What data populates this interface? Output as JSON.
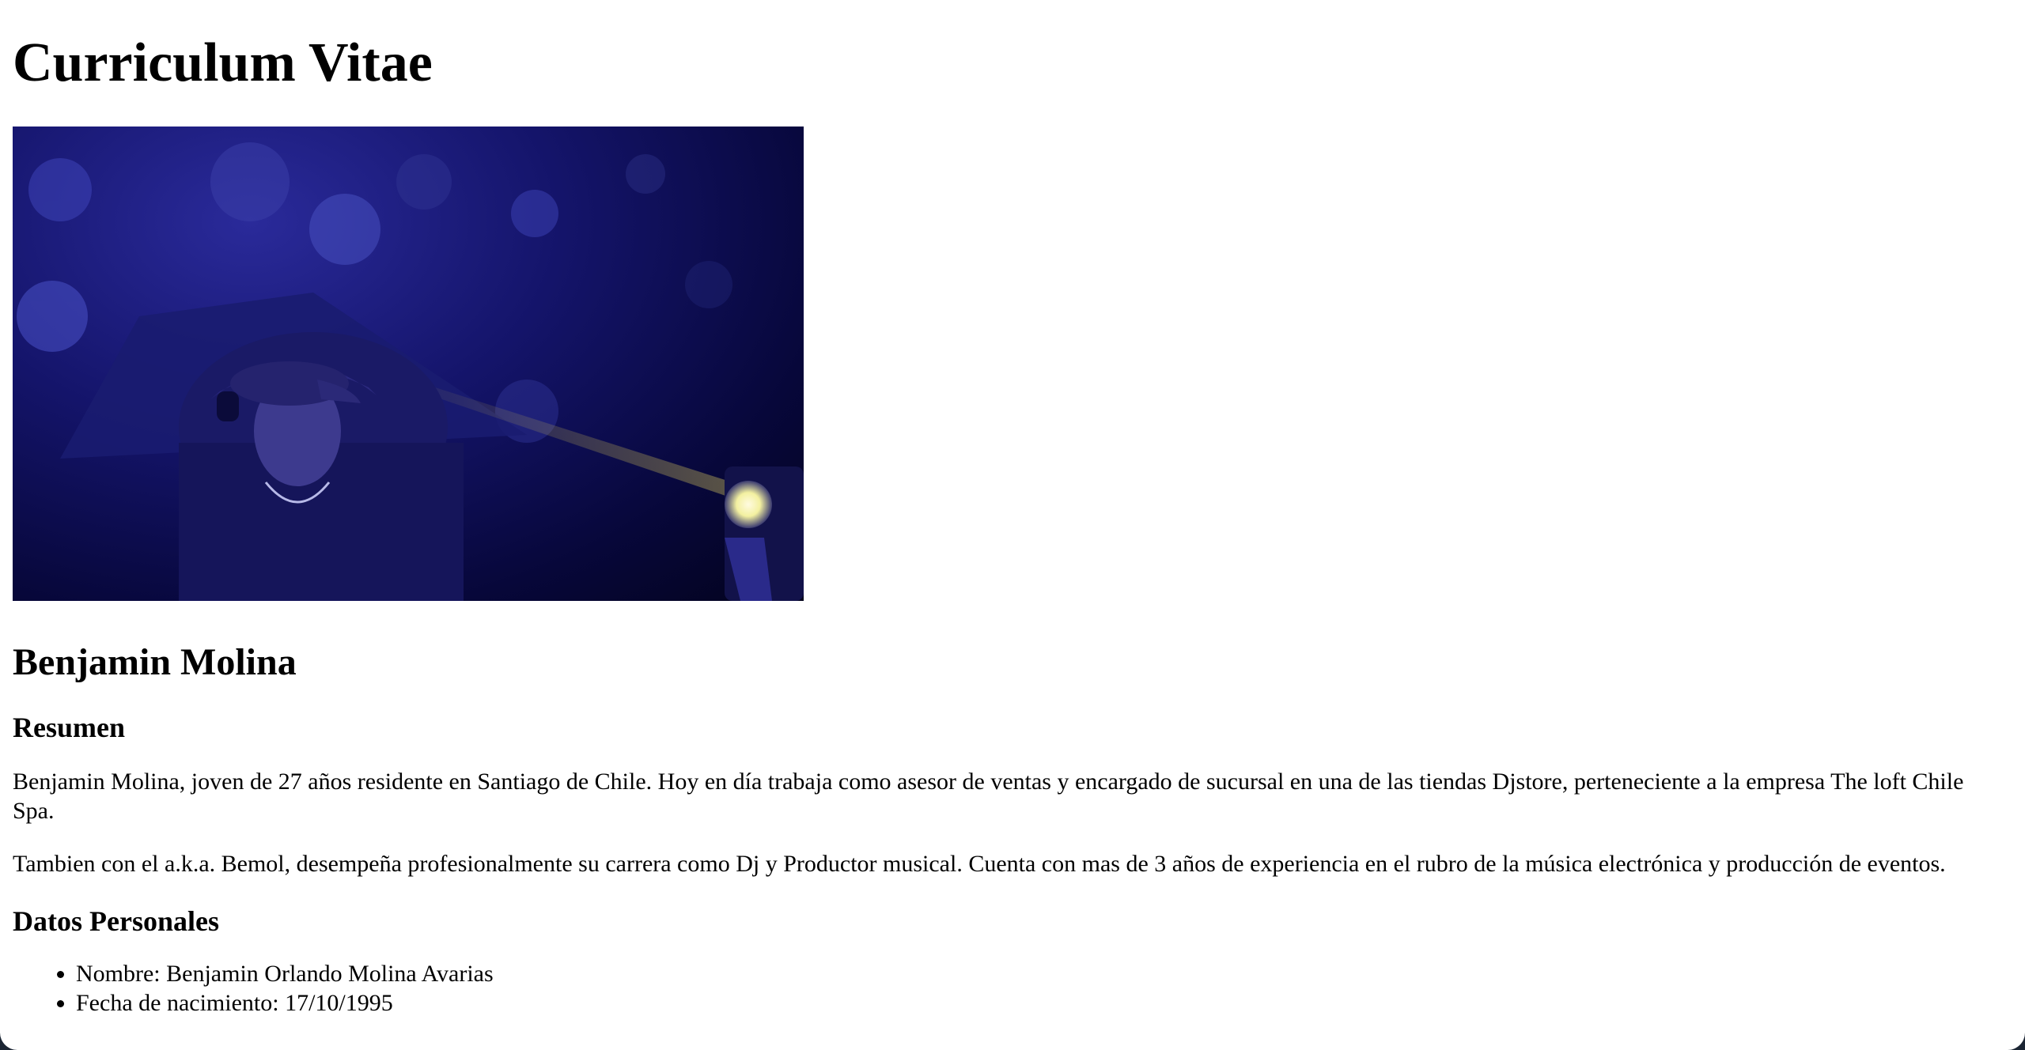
{
  "page": {
    "title": "Curriculum Vitae",
    "photo": {
      "alt": "Benjamin Molina"
    },
    "name": "Benjamin Molina",
    "summary": {
      "heading": "Resumen",
      "paragraphs": [
        "Benjamin Molina, joven de 27 años residente en Santiago de Chile. Hoy en día trabaja como asesor de ventas y encargado de sucursal en una de las tiendas Djstore, perteneciente a la empresa The loft Chile Spa.",
        "Tambien con el a.k.a. Bemol, desempeña profesionalmente su carrera como Dj y Productor musical. Cuenta con mas de 3 años de experiencia en el rubro de la música electrónica y producción de eventos."
      ]
    },
    "personal": {
      "heading": "Datos Personales",
      "items": [
        "Nombre: Benjamin Orlando Molina Avarias",
        "Fecha de nacimiento: 17/10/1995"
      ]
    }
  }
}
